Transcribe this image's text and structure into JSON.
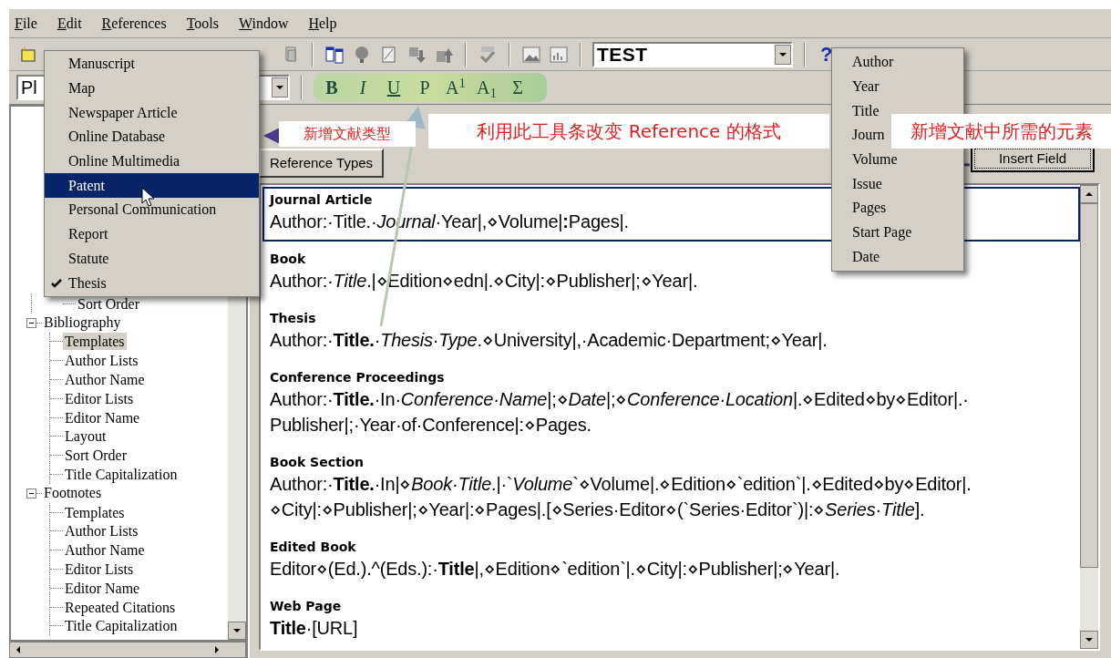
{
  "menu_bar": [
    "File",
    "Edit",
    "References",
    "Tools",
    "Window",
    "Help"
  ],
  "toolbar": {
    "style_field": "TEST",
    "font_field": "Pl",
    "help": "?"
  },
  "format_buttons": [
    {
      "label": "B",
      "kind": "bold"
    },
    {
      "label": "I",
      "kind": "italic"
    },
    {
      "label": "U",
      "kind": "underline"
    },
    {
      "label": "P",
      "kind": "plain"
    },
    {
      "label": "A$^{1}$",
      "kind": "plain"
    },
    {
      "label": "A$_{1}$",
      "kind": "plain"
    },
    {
      "label": "Σ",
      "kind": "plain"
    }
  ],
  "tree": {
    "orphan_items": [
      {
        "label": "Sort Order",
        "selected": false
      }
    ],
    "items": [
      {
        "label": "Bibliography",
        "expanded": true,
        "children": [
          {
            "label": "Templates",
            "selected": true
          },
          {
            "label": "Author Lists",
            "selected": false
          },
          {
            "label": "Author Name",
            "selected": false
          },
          {
            "label": "Editor Lists",
            "selected": false
          },
          {
            "label": "Editor Name",
            "selected": false
          },
          {
            "label": "Layout",
            "selected": false
          },
          {
            "label": "Sort Order",
            "selected": false
          },
          {
            "label": "Title Capitalization",
            "selected": false
          }
        ]
      },
      {
        "label": "Footnotes",
        "expanded": true,
        "children": [
          {
            "label": "Templates",
            "selected": false
          },
          {
            "label": "Author Lists",
            "selected": false
          },
          {
            "label": "Author Name",
            "selected": false
          },
          {
            "label": "Editor Lists",
            "selected": false
          },
          {
            "label": "Editor Name",
            "selected": false
          },
          {
            "label": "Repeated Citations",
            "selected": false
          },
          {
            "label": "Title Capitalization",
            "selected": false
          }
        ]
      }
    ]
  },
  "buttons": {
    "reference_types": "Reference Types",
    "insert_field": "Insert Field"
  },
  "templates": [
    {
      "type": "Journal Article",
      "selected": true,
      "lines": [
        "Author:·Title.·*Journal*·Year|,⋄Volume|**:**Pages|."
      ]
    },
    {
      "type": "Book",
      "selected": false,
      "lines": [
        "Author:·*Title*.|⋄Edition⋄edn|.⋄City|:⋄Publisher|;⋄Year|."
      ]
    },
    {
      "type": "Thesis",
      "selected": false,
      "lines": [
        "Author:·**Title.**·*Thesis·Type*.⋄University|,·Academic·Department;⋄Year|."
      ]
    },
    {
      "type": "Conference Proceedings",
      "selected": false,
      "lines": [
        "Author:·**Title.**·In·*Conference·Name*|;⋄*Date*|;⋄*Conference·Location*|.⋄Edited⋄by⋄Editor|.·",
        "Publisher|;·Year·of·Conference|:⋄Pages."
      ]
    },
    {
      "type": "Book Section",
      "selected": false,
      "lines": [
        "Author:·**Title.**·In|⋄*Book·Title*.|·`*Volume*`⋄Volume|.⋄Edition⋄`edition`|.⋄Edited⋄by⋄Editor|.",
        "⋄City|:⋄Publisher|;⋄Year|:⋄Pages|.[⋄Series·Editor⋄(`Series·Editor`)|:⋄*Series·Title*]."
      ]
    },
    {
      "type": "Edited Book",
      "selected": false,
      "lines": [
        "Editor⋄(Ed.).^(Eds.):·**Title**|,⋄Edition⋄`edition`|.⋄City|:⋄Publisher|;⋄Year|."
      ]
    },
    {
      "type": "Web Page",
      "selected": false,
      "lines": [
        "**Title**·[URL]"
      ]
    }
  ],
  "reference_type_menu": [
    {
      "label": "Manuscript",
      "highlighted": false,
      "checked": false
    },
    {
      "label": "Map",
      "highlighted": false,
      "checked": false
    },
    {
      "label": "Newspaper Article",
      "highlighted": false,
      "checked": false
    },
    {
      "label": "Online Database",
      "highlighted": false,
      "checked": false
    },
    {
      "label": "Online Multimedia",
      "highlighted": false,
      "checked": false
    },
    {
      "label": "Patent",
      "highlighted": true,
      "checked": false
    },
    {
      "label": "Personal Communication",
      "highlighted": false,
      "checked": false
    },
    {
      "label": "Report",
      "highlighted": false,
      "checked": false
    },
    {
      "label": "Statute",
      "highlighted": false,
      "checked": false
    },
    {
      "label": "Thesis",
      "highlighted": false,
      "checked": true
    }
  ],
  "field_menu": [
    "Author",
    "Year",
    "Title",
    "Journ",
    "Volume",
    "Issue",
    "Pages",
    "Start Page",
    "Date"
  ],
  "annotations": [
    "新增文献类型",
    "利用此工具条改变 Reference 的格式",
    "新增文献中所需的元素"
  ]
}
